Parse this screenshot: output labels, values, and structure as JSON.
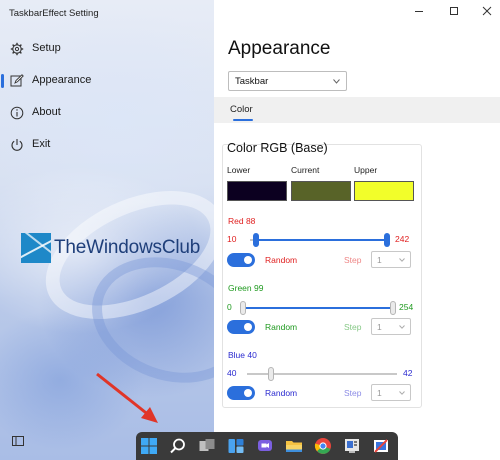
{
  "app": {
    "title": "TaskbarEffect Setting"
  },
  "sidebar": {
    "items": [
      {
        "label": "Setup",
        "icon": "gear-icon"
      },
      {
        "label": "Appearance",
        "icon": "edit-icon",
        "active": true
      },
      {
        "label": "About",
        "icon": "info-icon"
      },
      {
        "label": "Exit",
        "icon": "power-icon"
      }
    ]
  },
  "watermark": {
    "text": "TheWindowsClub"
  },
  "main": {
    "title": "Appearance",
    "dropdown": {
      "value": "Taskbar"
    },
    "tabs": [
      {
        "label": "Color"
      }
    ],
    "card": {
      "title": "Color RGB (Base)",
      "swatches": [
        {
          "label": "Lower",
          "color": "#0c0020"
        },
        {
          "label": "Current",
          "color": "#586328"
        },
        {
          "label": "Upper",
          "color": "#f2fe2a"
        }
      ],
      "channels": [
        {
          "title": "Red 88",
          "min": "10",
          "max": "242",
          "color": "#e02020",
          "random_label": "Random",
          "step_label": "Step",
          "step_value": "1",
          "range_start_frac": 0.041,
          "range_end_frac": 1.0
        },
        {
          "title": "Green 99",
          "min": "0",
          "max": "254",
          "color": "#1f9a1f",
          "random_label": "Random",
          "step_label": "Step",
          "step_value": "1",
          "range_start_frac": 0.0,
          "range_end_frac": 1.0
        },
        {
          "title": "Blue 40",
          "min": "40",
          "max": "42",
          "color": "#2a2ad0",
          "random_label": "Random",
          "step_label": "Step",
          "step_value": "1",
          "range_start_frac": 0.16,
          "range_end_frac": 0.165
        }
      ]
    }
  },
  "colors": {
    "accent": "#2b6fdc",
    "taskbar": "#3a3a3a",
    "tab_strip": "#f0f0f0"
  },
  "taskbar": {
    "icons": [
      "start-icon",
      "search-icon",
      "task-view-icon",
      "widgets-icon",
      "chat-icon",
      "file-explorer-icon",
      "chrome-icon",
      "settings-app-icon",
      "snipping-tool-icon"
    ]
  }
}
